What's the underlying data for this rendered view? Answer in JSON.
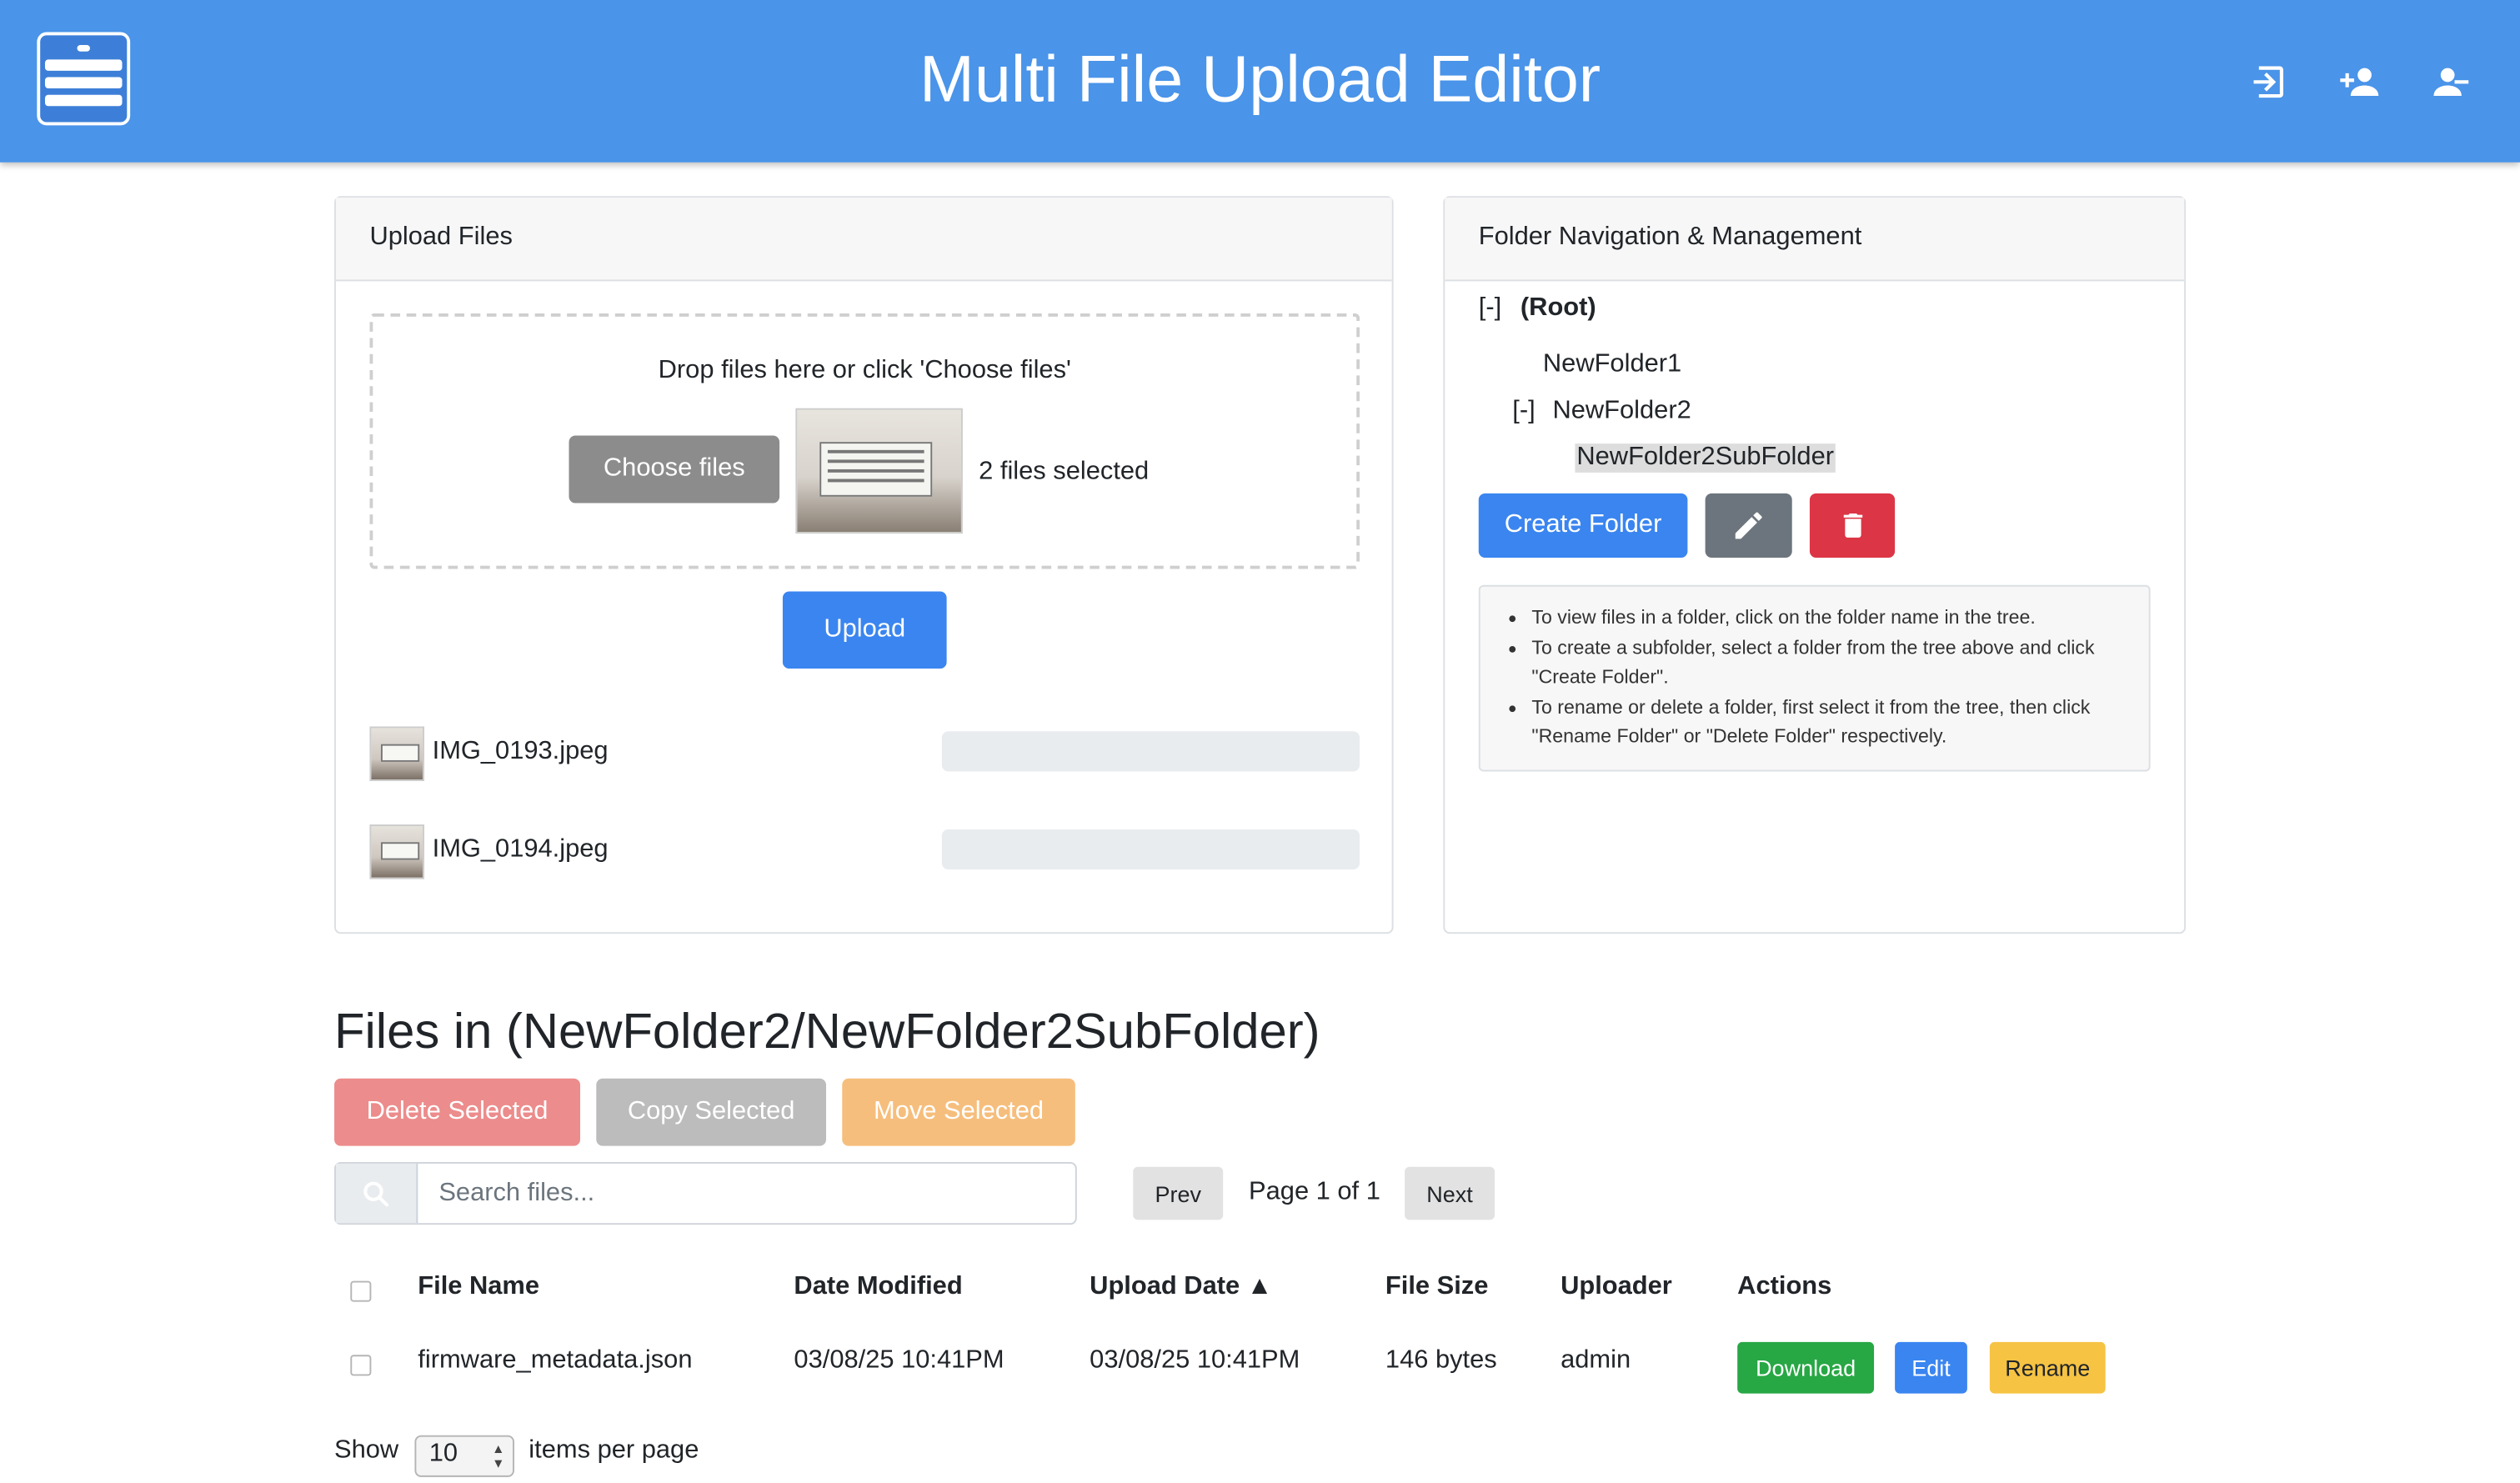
{
  "header": {
    "title": "Multi File Upload Editor",
    "icons": [
      "server-icon",
      "login-icon",
      "add-user-icon",
      "remove-user-icon"
    ]
  },
  "upload": {
    "title": "Upload Files",
    "drop_text": "Drop files here or click 'Choose files'",
    "choose_label": "Choose files",
    "selected_text": "2 files selected",
    "upload_label": "Upload",
    "files": [
      {
        "name": "IMG_0193.jpeg",
        "progress": 0
      },
      {
        "name": "IMG_0194.jpeg",
        "progress": 0
      }
    ]
  },
  "folders": {
    "title": "Folder Navigation & Management",
    "tree": {
      "root_toggle": "[-]",
      "root": "(Root)",
      "folder1": "NewFolder1",
      "folder2_toggle": "[-]",
      "folder2": "NewFolder2",
      "subfolder": "NewFolder2SubFolder"
    },
    "create_label": "Create Folder",
    "help": [
      "To view files in a folder, click on the folder name in the tree.",
      "To create a subfolder, select a folder from the tree above and click \"Create Folder\".",
      "To rename or delete a folder, first select it from the tree, then click \"Rename Folder\" or \"Delete Folder\" respectively."
    ]
  },
  "files_section": {
    "title": "Files in (NewFolder2/NewFolder2SubFolder)",
    "delete_label": "Delete Selected",
    "copy_label": "Copy Selected",
    "move_label": "Move Selected",
    "search_placeholder": "Search files...",
    "prev_label": "Prev",
    "page_text": "Page 1 of 1",
    "next_label": "Next",
    "columns": {
      "name": "File Name",
      "modified": "Date Modified",
      "uploaded": "Upload Date ▲",
      "size": "File Size",
      "uploader": "Uploader",
      "actions": "Actions"
    },
    "rows": [
      {
        "name": "firmware_metadata.json",
        "modified": "03/08/25 10:41PM",
        "uploaded": "03/08/25 10:41PM",
        "size": "146 bytes",
        "uploader": "admin",
        "download": "Download",
        "edit": "Edit",
        "rename": "Rename"
      }
    ],
    "show_label": "Show",
    "per_page_value": "10",
    "per_page_label": "items per page"
  },
  "colors": {
    "header": "#4a94e9",
    "primary": "#3a85f0",
    "danger": "#dc3545",
    "success": "#28a745",
    "warning": "#f6c343",
    "secondary": "#6c757d"
  }
}
